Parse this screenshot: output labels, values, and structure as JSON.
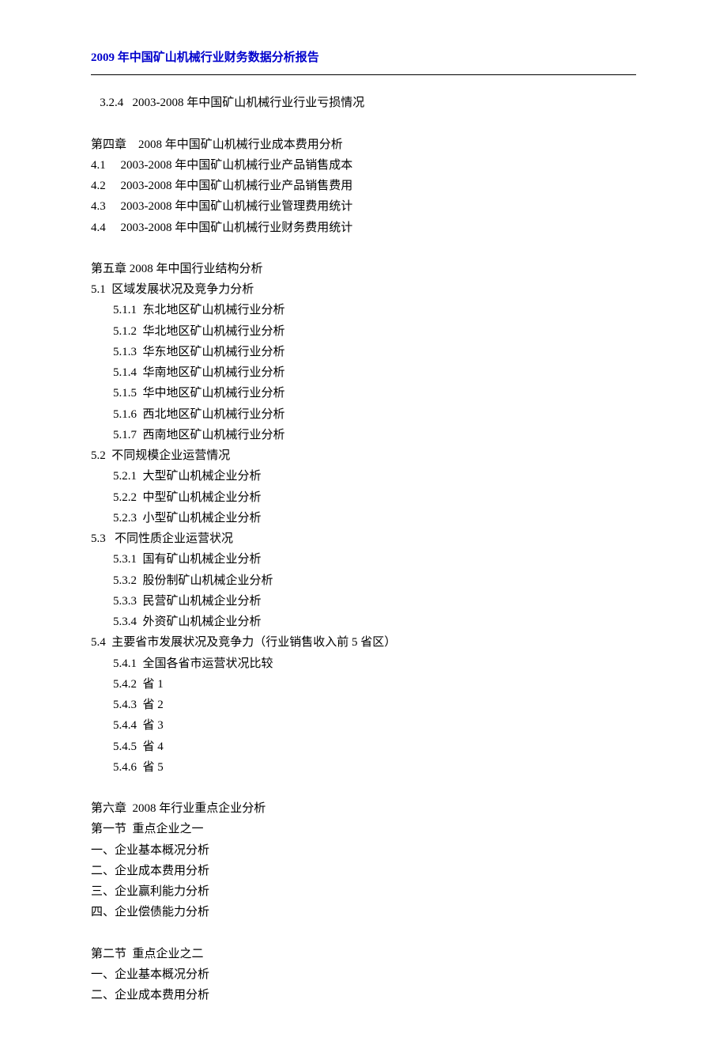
{
  "header": "2009 年中国矿山机械行业财务数据分析报告",
  "lines": [
    {
      "text": "   3.2.4   2003-2008 年中国矿山机械行业行业亏损情况",
      "indent": 0
    },
    {
      "spacer": true
    },
    {
      "text": "第四章    2008 年中国矿山机械行业成本费用分析",
      "indent": 0
    },
    {
      "text": "4.1     2003-2008 年中国矿山机械行业产品销售成本",
      "indent": 0
    },
    {
      "text": "4.2     2003-2008 年中国矿山机械行业产品销售费用",
      "indent": 0
    },
    {
      "text": "4.3     2003-2008 年中国矿山机械行业管理费用统计",
      "indent": 0
    },
    {
      "text": "4.4     2003-2008 年中国矿山机械行业财务费用统计",
      "indent": 0
    },
    {
      "spacer": true
    },
    {
      "text": "第五章 2008 年中国行业结构分析",
      "indent": 0
    },
    {
      "text": "5.1  区域发展状况及竞争力分析",
      "indent": 0
    },
    {
      "text": "5.1.1  东北地区矿山机械行业分析",
      "indent": 1
    },
    {
      "text": "5.1.2  华北地区矿山机械行业分析",
      "indent": 1
    },
    {
      "text": "5.1.3  华东地区矿山机械行业分析",
      "indent": 1
    },
    {
      "text": "5.1.4  华南地区矿山机械行业分析",
      "indent": 1
    },
    {
      "text": "5.1.5  华中地区矿山机械行业分析",
      "indent": 1
    },
    {
      "text": "5.1.6  西北地区矿山机械行业分析",
      "indent": 1
    },
    {
      "text": "5.1.7  西南地区矿山机械行业分析",
      "indent": 1
    },
    {
      "text": "5.2  不同规模企业运营情况",
      "indent": 0
    },
    {
      "text": "5.2.1  大型矿山机械企业分析",
      "indent": 1
    },
    {
      "text": "5.2.2  中型矿山机械企业分析",
      "indent": 1
    },
    {
      "text": "5.2.3  小型矿山机械企业分析",
      "indent": 1
    },
    {
      "text": "5.3   不同性质企业运营状况",
      "indent": 0
    },
    {
      "text": "5.3.1  国有矿山机械企业分析",
      "indent": 1
    },
    {
      "text": "5.3.2  股份制矿山机械企业分析",
      "indent": 1
    },
    {
      "text": "5.3.3  民营矿山机械企业分析",
      "indent": 1
    },
    {
      "text": "5.3.4  外资矿山机械企业分析",
      "indent": 1
    },
    {
      "text": "5.4  主要省市发展状况及竞争力（行业销售收入前 5 省区）",
      "indent": 0
    },
    {
      "text": "5.4.1  全国各省市运营状况比较",
      "indent": 1
    },
    {
      "text": "5.4.2  省 1",
      "indent": 1
    },
    {
      "text": "5.4.3  省 2",
      "indent": 1
    },
    {
      "text": "5.4.4  省 3",
      "indent": 1
    },
    {
      "text": "5.4.5  省 4",
      "indent": 1
    },
    {
      "text": "5.4.6  省 5",
      "indent": 1
    },
    {
      "spacer": true
    },
    {
      "text": "第六章  2008 年行业重点企业分析",
      "indent": 0
    },
    {
      "text": "第一节  重点企业之一",
      "indent": 0
    },
    {
      "text": "一、企业基本概况分析",
      "indent": 0
    },
    {
      "text": "二、企业成本费用分析",
      "indent": 0
    },
    {
      "text": "三、企业赢利能力分析",
      "indent": 0
    },
    {
      "text": "四、企业偿债能力分析",
      "indent": 0
    },
    {
      "spacer": true
    },
    {
      "text": "第二节  重点企业之二",
      "indent": 0
    },
    {
      "text": "一、企业基本概况分析",
      "indent": 0
    },
    {
      "text": "二、企业成本费用分析",
      "indent": 0
    }
  ]
}
